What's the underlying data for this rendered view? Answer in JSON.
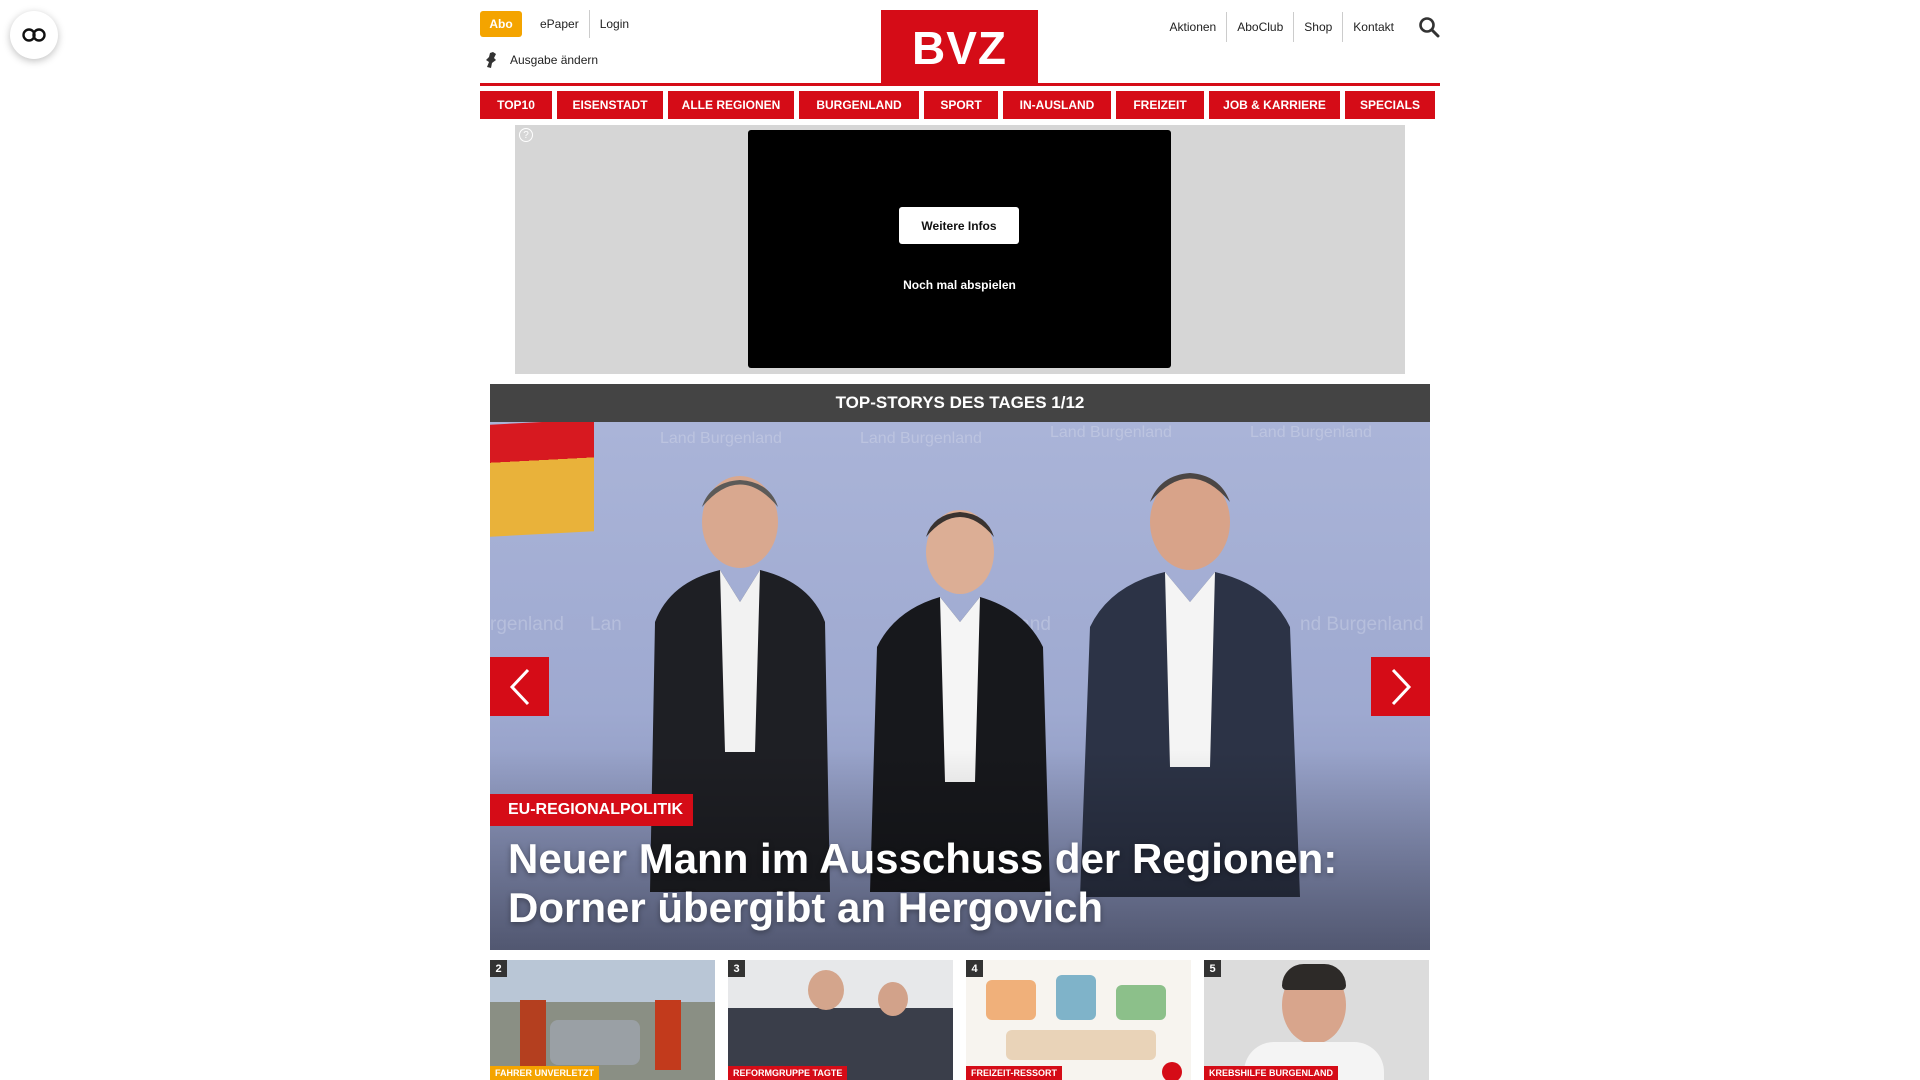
{
  "header": {
    "abo": "Abo",
    "links_left": [
      "ePaper",
      "Login"
    ],
    "ausgabe": "Ausgabe ändern",
    "logo": "BVZ",
    "links_right": [
      "Aktionen",
      "AboClub",
      "Shop",
      "Kontakt"
    ]
  },
  "nav": [
    "TOP10",
    "EISENSTADT",
    "ALLE REGIONEN",
    "BURGENLAND",
    "SPORT",
    "IN-AUSLAND",
    "FREIZEIT",
    "JOB & KARRIERE",
    "SPECIALS"
  ],
  "ad": {
    "more_info": "Weitere Infos",
    "replay": "Noch mal abspielen"
  },
  "top_stories": {
    "title": "TOP-STORYS DES TAGES 1/12",
    "hero_tag": "EU-REGIONALPOLITIK",
    "hero_title": "Neuer Mann im Ausschuss der Regionen: Dorner übergibt an Hergovich",
    "watermarks": [
      "Land Burgenland",
      "Land Burgenland",
      "Land Burgenland",
      "Land Burgenland",
      "rgenland",
      "Lan",
      "land",
      "nd Burgenland"
    ]
  },
  "thumbs": [
    {
      "num": "2",
      "tag": "FAHRER UNVERLETZT",
      "tag_color": "#f4a400"
    },
    {
      "num": "3",
      "tag": "REFORMGRUPPE TAGTE",
      "tag_color": "#d50c17"
    },
    {
      "num": "4",
      "tag": "FREIZEIT-RESSORT",
      "tag_color": "#d50c17"
    },
    {
      "num": "5",
      "tag": "KREBSHILFE BURGENLAND",
      "tag_color": "#d50c17"
    }
  ],
  "colors": {
    "brand_red": "#d50c17",
    "abo_orange": "#f4a400",
    "bar_gray": "#444444"
  }
}
